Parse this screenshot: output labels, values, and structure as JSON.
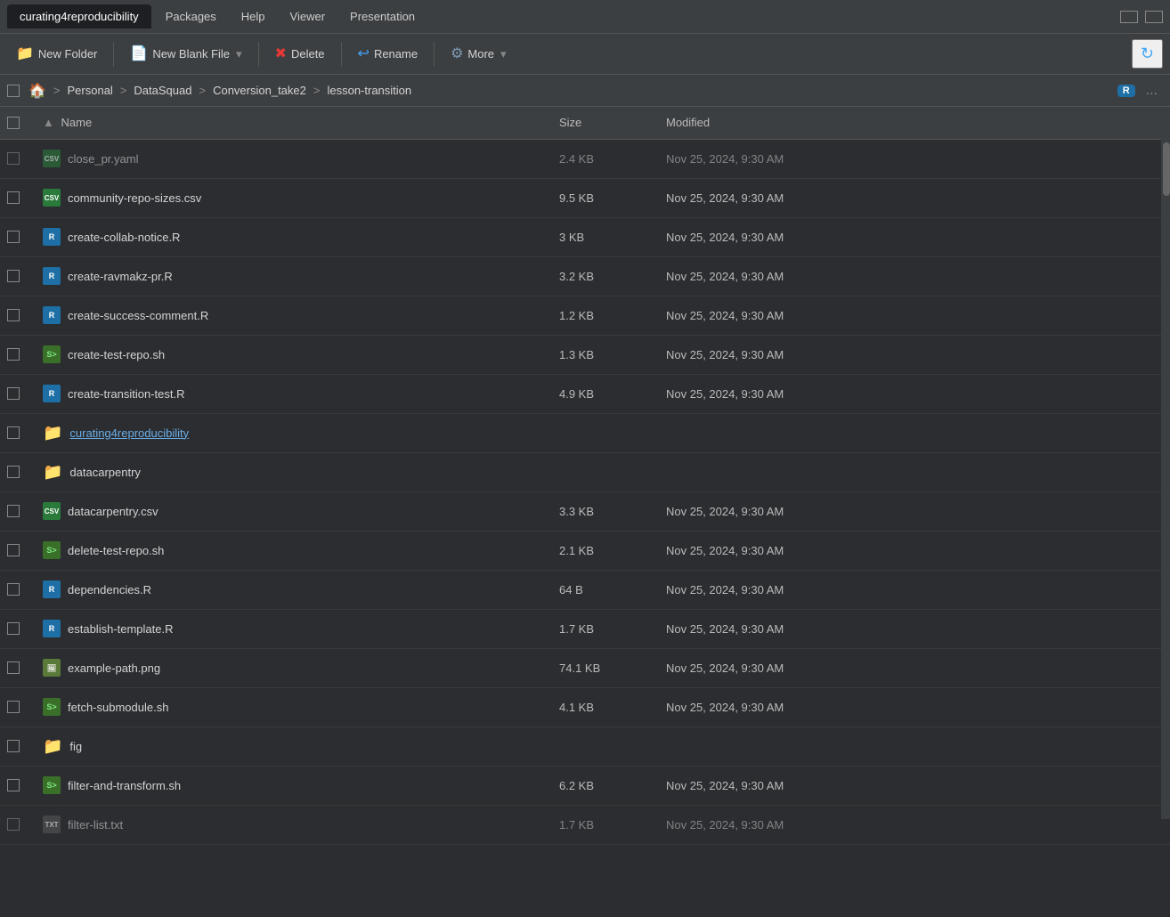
{
  "titlebar": {
    "active_tab": "curating4reproducibility",
    "menus": [
      "Packages",
      "Help",
      "Viewer",
      "Presentation"
    ],
    "window_controls": [
      "minimize",
      "maximize"
    ]
  },
  "toolbar": {
    "new_folder_label": "New Folder",
    "new_blank_file_label": "New Blank File",
    "delete_label": "Delete",
    "rename_label": "Rename",
    "more_label": "More",
    "refresh_icon": "↻"
  },
  "breadcrumb": {
    "home_icon": "🏠",
    "items": [
      "Home",
      "Personal",
      "DataSquad",
      "Conversion_take2",
      "lesson-transition"
    ],
    "separators": [
      ">",
      ">",
      ">",
      ">"
    ],
    "r_badge": "R",
    "dots": "..."
  },
  "table": {
    "columns": [
      "Name",
      "Size",
      "Modified"
    ],
    "sort_col": "Name",
    "sort_dir": "asc",
    "files": [
      {
        "name": "close_pr.yaml",
        "icon": "csv",
        "size": "2.4 KB",
        "modified": "Nov 25, 2024, 9:30 AM",
        "faded": true
      },
      {
        "name": "community-repo-sizes.csv",
        "icon": "csv",
        "size": "9.5 KB",
        "modified": "Nov 25, 2024, 9:30 AM",
        "faded": false
      },
      {
        "name": "create-collab-notice.R",
        "icon": "r",
        "size": "3 KB",
        "modified": "Nov 25, 2024, 9:30 AM",
        "faded": false
      },
      {
        "name": "create-ravmakz-pr.R",
        "icon": "r",
        "size": "3.2 KB",
        "modified": "Nov 25, 2024, 9:30 AM",
        "faded": false
      },
      {
        "name": "create-success-comment.R",
        "icon": "r",
        "size": "1.2 KB",
        "modified": "Nov 25, 2024, 9:30 AM",
        "faded": false
      },
      {
        "name": "create-test-repo.sh",
        "icon": "sh",
        "size": "1.3 KB",
        "modified": "Nov 25, 2024, 9:30 AM",
        "faded": false
      },
      {
        "name": "create-transition-test.R",
        "icon": "r",
        "size": "4.9 KB",
        "modified": "Nov 25, 2024, 9:30 AM",
        "faded": false
      },
      {
        "name": "curating4reproducibility",
        "icon": "folder",
        "size": "",
        "modified": "",
        "link": true,
        "faded": false
      },
      {
        "name": "datacarpentry",
        "icon": "folder",
        "size": "",
        "modified": "",
        "faded": false
      },
      {
        "name": "datacarpentry.csv",
        "icon": "csv",
        "size": "3.3 KB",
        "modified": "Nov 25, 2024, 9:30 AM",
        "faded": false
      },
      {
        "name": "delete-test-repo.sh",
        "icon": "sh",
        "size": "2.1 KB",
        "modified": "Nov 25, 2024, 9:30 AM",
        "faded": false
      },
      {
        "name": "dependencies.R",
        "icon": "r",
        "size": "64 B",
        "modified": "Nov 25, 2024, 9:30 AM",
        "faded": false
      },
      {
        "name": "establish-template.R",
        "icon": "r",
        "size": "1.7 KB",
        "modified": "Nov 25, 2024, 9:30 AM",
        "faded": false
      },
      {
        "name": "example-path.png",
        "icon": "png",
        "size": "74.1 KB",
        "modified": "Nov 25, 2024, 9:30 AM",
        "faded": false
      },
      {
        "name": "fetch-submodule.sh",
        "icon": "sh",
        "size": "4.1 KB",
        "modified": "Nov 25, 2024, 9:30 AM",
        "faded": false
      },
      {
        "name": "fig",
        "icon": "folder",
        "size": "",
        "modified": "",
        "faded": false
      },
      {
        "name": "filter-and-transform.sh",
        "icon": "sh",
        "size": "6.2 KB",
        "modified": "Nov 25, 2024, 9:30 AM",
        "faded": false
      },
      {
        "name": "filter-list.txt",
        "icon": "txt",
        "size": "1.7 KB",
        "modified": "Nov 25, 2024, 9:30 AM",
        "faded": true
      }
    ]
  }
}
